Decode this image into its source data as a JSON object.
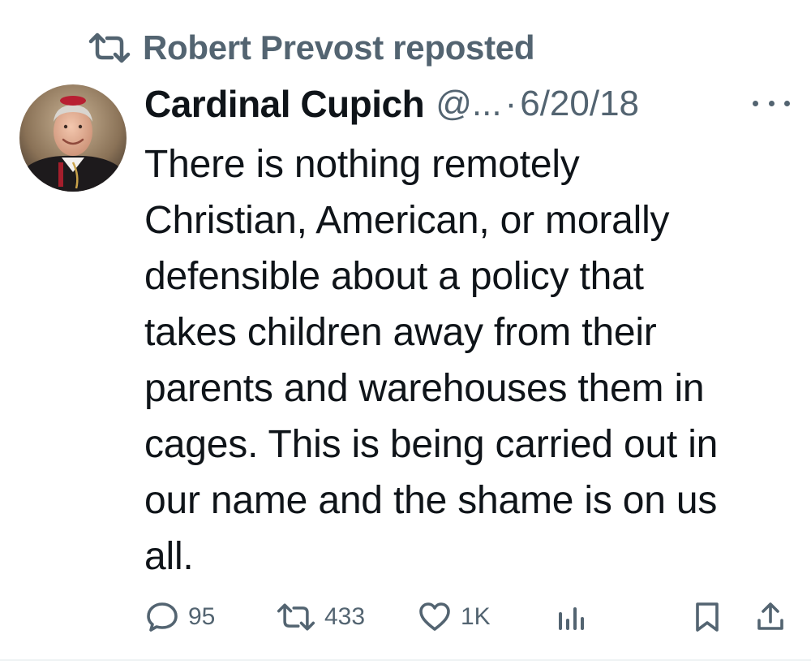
{
  "repost": {
    "icon": "repost-icon",
    "text": "Robert Prevost reposted"
  },
  "author": {
    "avatar": "avatar-photo",
    "name": "Cardinal Cupich",
    "handle": "@...",
    "separator": "·",
    "date": "6/20/18"
  },
  "more_icon": "more-options-icon",
  "tweet": {
    "lines": [
      "There is nothing remotely",
      "Christian, American, or morally",
      "defensible about a policy that",
      "takes children away from their",
      "parents and warehouses them in",
      "cages. This is being carried out in",
      "our name and the shame is on us",
      "all."
    ]
  },
  "actions": {
    "reply": {
      "icon": "reply-icon",
      "count": "95"
    },
    "repost": {
      "icon": "repost-icon",
      "count": "433"
    },
    "like": {
      "icon": "like-icon",
      "count": "1K"
    },
    "views": {
      "icon": "views-icon"
    },
    "bookmark": {
      "icon": "bookmark-icon"
    },
    "share": {
      "icon": "share-icon"
    }
  },
  "colors": {
    "text": "#0f1419",
    "secondary": "#536471",
    "background": "#ffffff"
  }
}
